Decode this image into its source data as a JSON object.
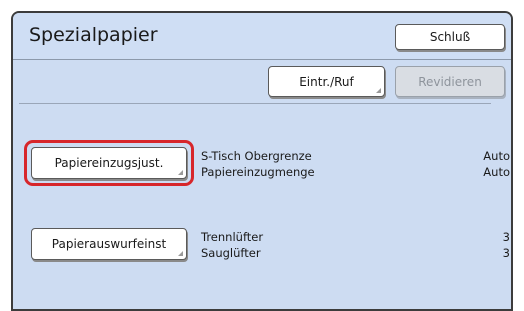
{
  "window": {
    "title": "Spezialpapier"
  },
  "buttons": {
    "close": "Schluß",
    "entry_recall": "Eintr./Ruf",
    "revise": "Revidieren",
    "feed_adjust": "Papiereinzugsjust.",
    "eject_fine": "Papierauswurfeinst"
  },
  "feed_settings": [
    {
      "label": "S-Tisch Obergrenze",
      "value": "Auto"
    },
    {
      "label": "Papiereinzugmenge",
      "value": "Auto"
    }
  ],
  "eject_settings": [
    {
      "label": "Trennlüfter",
      "value": "3"
    },
    {
      "label": "Sauglüfter",
      "value": "3"
    }
  ],
  "colors": {
    "highlight": "#d7262b",
    "panel_bg": "#cddcf2"
  }
}
